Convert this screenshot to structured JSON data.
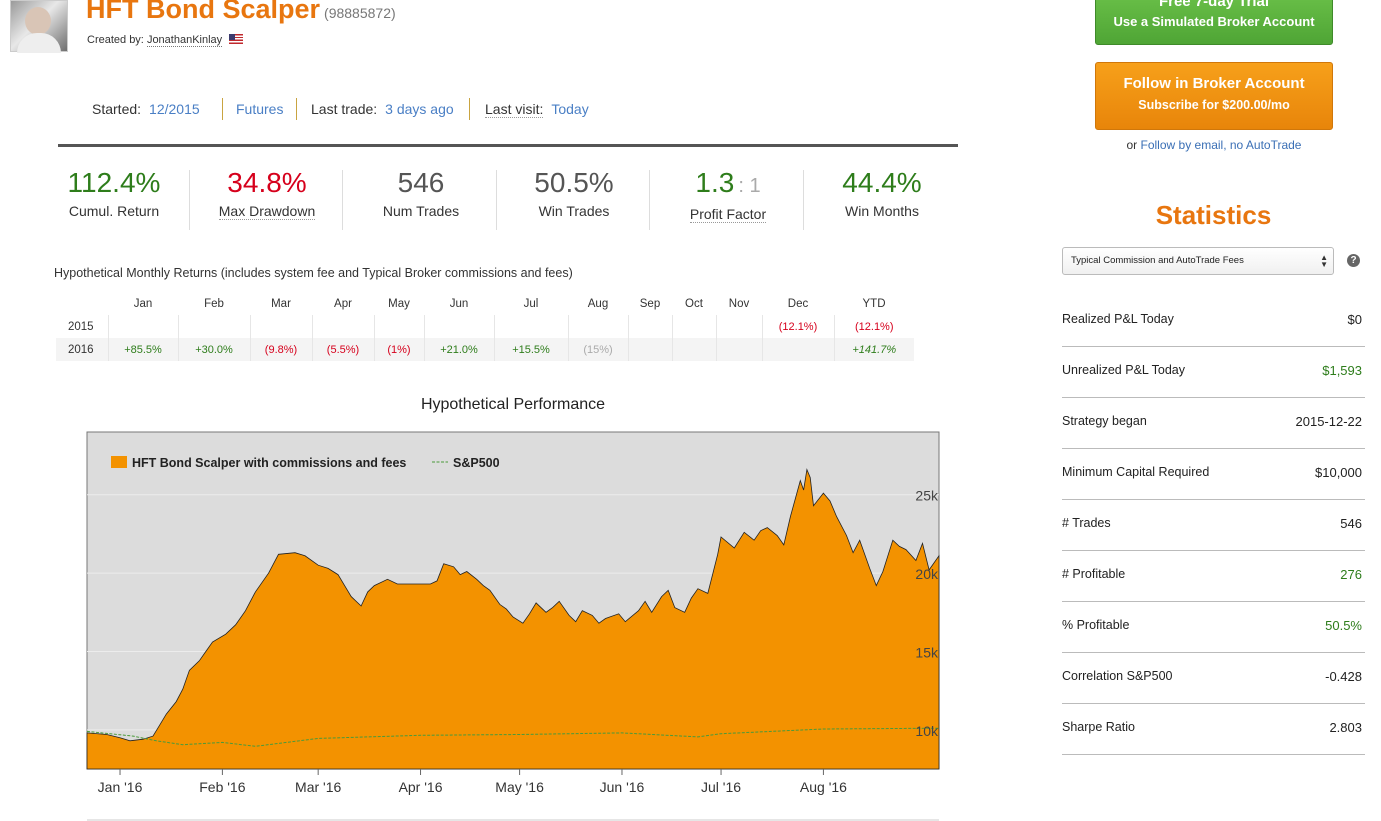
{
  "header": {
    "title": "HFT Bond Scalper",
    "system_id": "(98885872)",
    "created_by_label": "Created by:",
    "creator": "JonathanKinlay"
  },
  "meta": {
    "started_label": "Started:",
    "started_value": "12/2015",
    "market": "Futures",
    "last_trade_label": "Last trade:",
    "last_trade_value": "3 days ago",
    "last_visit_label": "Last visit:",
    "last_visit_value": "Today"
  },
  "kpis": [
    {
      "value": "112.4%",
      "label": "Cumul. Return",
      "color": "#2e7d1b"
    },
    {
      "value": "34.8%",
      "label": "Max Drawdown",
      "color": "#d6001c"
    },
    {
      "value": "546",
      "label": "Num Trades",
      "color": "#555555"
    },
    {
      "value": "50.5%",
      "label": "Win Trades",
      "color": "#555555"
    },
    {
      "value": "1.3",
      "value_suffix": ": 1",
      "label": "Profit Factor",
      "color": "#2e7d1b"
    },
    {
      "value": "44.4%",
      "label": "Win Months",
      "color": "#2e7d1b"
    }
  ],
  "monthly": {
    "caption": "Hypothetical Monthly Returns (includes system fee and Typical Broker commissions and fees)",
    "headers": [
      "Jan",
      "Feb",
      "Mar",
      "Apr",
      "May",
      "Jun",
      "Jul",
      "Aug",
      "Sep",
      "Oct",
      "Nov",
      "Dec",
      "YTD"
    ],
    "rows": [
      {
        "year": "2015",
        "cells": [
          "",
          "",
          "",
          "",
          "",
          "",
          "",
          "",
          "",
          "",
          "",
          "(12.1%)",
          "(12.1%)"
        ]
      },
      {
        "year": "2016",
        "cells": [
          "+85.5%",
          "+30.0%",
          "(9.8%)",
          "(5.5%)",
          "(1%)",
          "+21.0%",
          "+15.5%",
          "(15%)",
          "",
          "",
          "",
          "",
          "+141.7%"
        ]
      }
    ]
  },
  "chart_data": {
    "type": "area",
    "title": "Hypothetical Performance",
    "series": [
      {
        "name": "HFT Bond Scalper with commissions and fees",
        "color": "#f39200",
        "points": [
          [
            "2015-12-22",
            9800
          ],
          [
            "2015-12-28",
            9700
          ],
          [
            "2016-01-01",
            9500
          ],
          [
            "2016-01-04",
            9300
          ],
          [
            "2016-01-08",
            9400
          ],
          [
            "2016-01-11",
            9600
          ],
          [
            "2016-01-13",
            10300
          ],
          [
            "2016-01-15",
            11000
          ],
          [
            "2016-01-18",
            11800
          ],
          [
            "2016-01-20",
            12600
          ],
          [
            "2016-01-22",
            13800
          ],
          [
            "2016-01-25",
            14400
          ],
          [
            "2016-01-27",
            15000
          ],
          [
            "2016-01-29",
            15600
          ],
          [
            "2016-02-02",
            16100
          ],
          [
            "2016-02-05",
            16700
          ],
          [
            "2016-02-08",
            17600
          ],
          [
            "2016-02-11",
            18800
          ],
          [
            "2016-02-15",
            20000
          ],
          [
            "2016-02-18",
            21200
          ],
          [
            "2016-02-23",
            21300
          ],
          [
            "2016-02-26",
            21100
          ],
          [
            "2016-03-01",
            20500
          ],
          [
            "2016-03-04",
            20300
          ],
          [
            "2016-03-07",
            19900
          ],
          [
            "2016-03-09",
            19200
          ],
          [
            "2016-03-11",
            18500
          ],
          [
            "2016-03-14",
            17900
          ],
          [
            "2016-03-16",
            18800
          ],
          [
            "2016-03-18",
            19200
          ],
          [
            "2016-03-22",
            19600
          ],
          [
            "2016-03-25",
            19300
          ],
          [
            "2016-03-31",
            19300
          ],
          [
            "2016-04-04",
            19300
          ],
          [
            "2016-04-06",
            19500
          ],
          [
            "2016-04-08",
            20600
          ],
          [
            "2016-04-11",
            20400
          ],
          [
            "2016-04-13",
            19900
          ],
          [
            "2016-04-15",
            20100
          ],
          [
            "2016-04-18",
            19600
          ],
          [
            "2016-04-20",
            19200
          ],
          [
            "2016-04-22",
            18900
          ],
          [
            "2016-04-25",
            18000
          ],
          [
            "2016-04-27",
            17700
          ],
          [
            "2016-04-29",
            17200
          ],
          [
            "2016-05-02",
            16800
          ],
          [
            "2016-05-04",
            17400
          ],
          [
            "2016-05-06",
            18100
          ],
          [
            "2016-05-09",
            17500
          ],
          [
            "2016-05-11",
            17800
          ],
          [
            "2016-05-13",
            18200
          ],
          [
            "2016-05-16",
            17300
          ],
          [
            "2016-05-18",
            16900
          ],
          [
            "2016-05-20",
            17600
          ],
          [
            "2016-05-23",
            17300
          ],
          [
            "2016-05-25",
            16800
          ],
          [
            "2016-05-27",
            17100
          ],
          [
            "2016-05-31",
            17400
          ],
          [
            "2016-06-02",
            16900
          ],
          [
            "2016-06-06",
            17600
          ],
          [
            "2016-06-08",
            18200
          ],
          [
            "2016-06-10",
            17500
          ],
          [
            "2016-06-13",
            18500
          ],
          [
            "2016-06-15",
            18900
          ],
          [
            "2016-06-17",
            17800
          ],
          [
            "2016-06-20",
            17500
          ],
          [
            "2016-06-22",
            18400
          ],
          [
            "2016-06-24",
            19000
          ],
          [
            "2016-06-27",
            18700
          ],
          [
            "2016-06-30",
            21200
          ],
          [
            "2016-07-01",
            22300
          ],
          [
            "2016-07-05",
            21600
          ],
          [
            "2016-07-08",
            22600
          ],
          [
            "2016-07-11",
            22100
          ],
          [
            "2016-07-13",
            22700
          ],
          [
            "2016-07-15",
            22900
          ],
          [
            "2016-07-18",
            22400
          ],
          [
            "2016-07-20",
            21800
          ],
          [
            "2016-07-22",
            23600
          ],
          [
            "2016-07-25",
            25900
          ],
          [
            "2016-07-26",
            25300
          ],
          [
            "2016-07-27",
            26600
          ],
          [
            "2016-07-28",
            26100
          ],
          [
            "2016-07-29",
            24300
          ],
          [
            "2016-08-01",
            25100
          ],
          [
            "2016-08-03",
            24600
          ],
          [
            "2016-08-05",
            23600
          ],
          [
            "2016-08-08",
            22400
          ],
          [
            "2016-08-10",
            21300
          ],
          [
            "2016-08-12",
            22100
          ],
          [
            "2016-08-15",
            20300
          ],
          [
            "2016-08-17",
            19200
          ],
          [
            "2016-08-19",
            20100
          ],
          [
            "2016-08-22",
            22100
          ],
          [
            "2016-08-24",
            21700
          ],
          [
            "2016-08-26",
            21500
          ],
          [
            "2016-08-29",
            20800
          ],
          [
            "2016-08-31",
            21900
          ],
          [
            "2016-09-02",
            20200
          ],
          [
            "2016-09-05",
            21100
          ]
        ]
      },
      {
        "name": "S&P500",
        "color": "#4a9a3a",
        "points": [
          [
            "2015-12-22",
            9900
          ],
          [
            "2016-01-05",
            9600
          ],
          [
            "2016-01-12",
            9300
          ],
          [
            "2016-01-20",
            9050
          ],
          [
            "2016-02-01",
            9200
          ],
          [
            "2016-02-11",
            8950
          ],
          [
            "2016-03-01",
            9450
          ],
          [
            "2016-04-01",
            9650
          ],
          [
            "2016-05-01",
            9700
          ],
          [
            "2016-06-01",
            9800
          ],
          [
            "2016-06-24",
            9550
          ],
          [
            "2016-07-01",
            9750
          ],
          [
            "2016-08-01",
            10050
          ],
          [
            "2016-09-05",
            10100
          ]
        ]
      }
    ],
    "x_ticks": [
      "Jan '16",
      "Feb '16",
      "Mar '16",
      "Apr '16",
      "May '16",
      "Jun '16",
      "Jul '16",
      "Aug '16"
    ],
    "y_ticks": [
      "10k",
      "15k",
      "20k",
      "25k"
    ],
    "ylim": [
      7500,
      29000
    ],
    "grid": true,
    "legend": "top-left"
  },
  "sidebar": {
    "trial_line1": "Free 7-day Trial",
    "trial_line2": "Use a Simulated Broker Account",
    "follow_line1": "Follow in Broker Account",
    "follow_line2": "Subscribe for $200.00/mo",
    "or_text": "or",
    "follow_email": "Follow by email, no AutoTrade",
    "stats_title": "Statistics",
    "select_value": "Typical Commission and AutoTrade Fees",
    "stats": [
      {
        "label": "Realized P&L Today",
        "value": "$0",
        "green": false
      },
      {
        "label": "Unrealized P&L Today",
        "value": "$1,593",
        "green": true
      },
      {
        "label": "Strategy began",
        "value": "2015-12-22",
        "green": false
      },
      {
        "label": "Minimum Capital Required",
        "value": "$10,000",
        "green": false
      },
      {
        "label": "# Trades",
        "value": "546",
        "green": false
      },
      {
        "label": "# Profitable",
        "value": "276",
        "green": true
      },
      {
        "label": "% Profitable",
        "value": "50.5%",
        "green": true
      },
      {
        "label": "Correlation S&P500",
        "value": "-0.428",
        "green": false
      },
      {
        "label": "Sharpe Ratio",
        "value": "2.803",
        "green": false
      }
    ]
  }
}
